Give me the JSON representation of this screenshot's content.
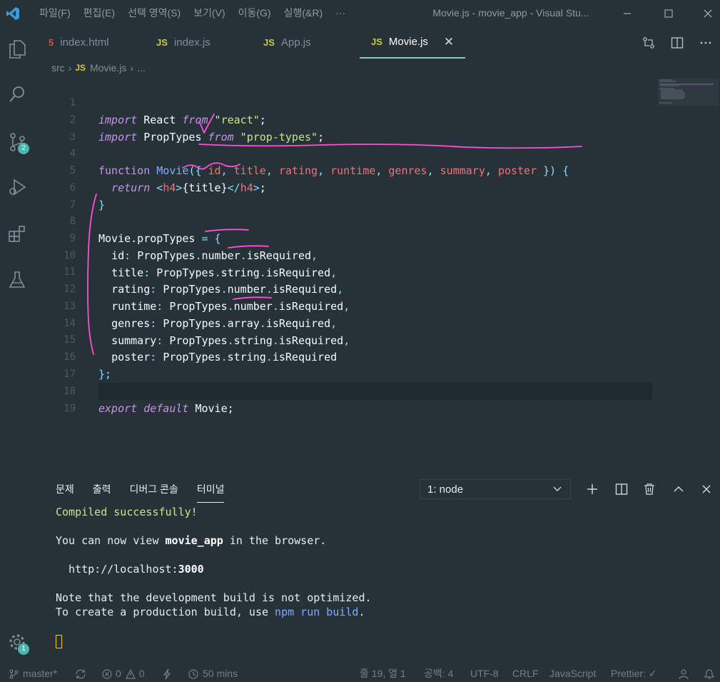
{
  "window": {
    "title": "Movie.js - movie_app - Visual Stu...",
    "menu": [
      "파일(F)",
      "편집(E)",
      "선택 영역(S)",
      "보기(V)",
      "이동(G)",
      "실행(&R)",
      "···"
    ]
  },
  "activity": {
    "source_control_badge": "2",
    "settings_badge": "1"
  },
  "tabs": [
    {
      "icon": "5",
      "label": "index.html"
    },
    {
      "icon": "JS",
      "label": "index.js"
    },
    {
      "icon": "JS",
      "label": "App.js"
    },
    {
      "icon": "JS",
      "label": "Movie.js",
      "close": "✕"
    }
  ],
  "breadcrumb": {
    "folder": "src",
    "icon": "JS",
    "file": "Movie.js",
    "more": "..."
  },
  "editor": {
    "line_numbers": [
      "1",
      "2",
      "3",
      "4",
      "5",
      "6",
      "7",
      "8",
      "9",
      "10",
      "11",
      "12",
      "13",
      "14",
      "15",
      "16",
      "17",
      "18",
      "19"
    ],
    "l1": {
      "kw": "import",
      "name": " React ",
      "from": "from",
      "str": " \"react\"",
      "end": ";"
    },
    "l2": {
      "kw": "import",
      "name": " PropTypes ",
      "from": "from",
      "str": " \"prop-types\"",
      "end": ";"
    },
    "l4": {
      "kw": "function",
      "fn": " Movie",
      "open": "({ ",
      "p1": "id",
      "p2": "title",
      "p3": "rating",
      "p4": "runtime",
      "p5": "genres",
      "p6": "summary",
      "p7": "poster",
      "comma": ", ",
      "close": " }) {"
    },
    "l5": {
      "kw": "return",
      "lt": " <",
      "tag": "h4",
      "gt": ">",
      "expr": "{title}",
      "lt2": "</",
      "tag2": "h4",
      "gt2": ">",
      "end": ";"
    },
    "l6": "}",
    "l8": {
      "obj": "Movie.propTypes",
      "eq": " = {"
    },
    "props": [
      {
        "key": "id",
        "type": "number",
        "req": "isRequired",
        "end": ","
      },
      {
        "key": "title",
        "type": "string",
        "req": "isRequired",
        "end": ","
      },
      {
        "key": "rating",
        "type": "number",
        "req": "isRequired",
        "end": ","
      },
      {
        "key": "runtime",
        "type": "number",
        "req": "isRequired",
        "end": ","
      },
      {
        "key": "genres",
        "type": "array",
        "req": "isRequired",
        "end": ","
      },
      {
        "key": "summary",
        "type": "string",
        "req": "isRequired",
        "end": ","
      },
      {
        "key": "poster",
        "type": "string",
        "req": "isRequired",
        "end": ""
      }
    ],
    "proptypes_obj": "PropTypes",
    "l16": "};",
    "l18": {
      "kw1": "export",
      "kw2": "default",
      "name": " Movie",
      "end": ";"
    }
  },
  "panel": {
    "tabs": [
      "문제",
      "출력",
      "디버그 콘솔",
      "터미널"
    ],
    "terminal_select": "1: node",
    "terminal": {
      "compiled": "Compiled successfully!",
      "view_pre": "You can now view ",
      "view_app": "movie_app",
      "view_post": " in the browser.",
      "url_pre": "  http://localhost:",
      "url_port": "3000",
      "note1": "Note that the development build is not optimized.",
      "note2_pre": "To create a production build, use ",
      "note2_cmd": "npm run build",
      "note2_post": "."
    }
  },
  "status": {
    "branch": "master*",
    "errors": "0",
    "warnings": "0",
    "time": "50 mins",
    "position": "줄 19, 열 1",
    "spaces": "공백: 4",
    "encoding": "UTF-8",
    "eol": "CRLF",
    "language": "JavaScript",
    "prettier": "Prettier: ✓"
  },
  "colors": {
    "background": "#263238",
    "keyword": "#c792ea",
    "function": "#82aaff",
    "string": "#c3e88d",
    "parameter": "#f07178",
    "annotation_ink": "#ff4fd8",
    "accent": "#80cbc4"
  }
}
